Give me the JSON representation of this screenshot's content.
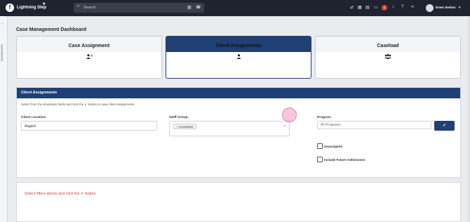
{
  "app": {
    "logo_letter": "f",
    "name": "Lightning Step"
  },
  "search": {
    "placeholder": "Search"
  },
  "notifications": {
    "count": "1"
  },
  "user": {
    "name": "Drew Serkez"
  },
  "rail": {
    "label": "DASHBOARD"
  },
  "page": {
    "title": "Case Management Dashboard"
  },
  "tiles": [
    {
      "label": "Case Assignment",
      "icon": "user-plus-icon"
    },
    {
      "label": "Client Assignments",
      "icon": "user-icon",
      "active": true
    },
    {
      "label": "Caseload",
      "icon": "users-icon"
    }
  ],
  "panel": {
    "title": "Client Assignments",
    "instruction": "Select from the dropdown fields and click the ✔ button to view client assignments",
    "client_location": {
      "label": "Client Location:",
      "value": "Asgard"
    },
    "staff_group": {
      "label": "Staff Group:",
      "tag": "Counselor",
      "tag_remove": "×"
    },
    "program": {
      "label": "Program",
      "placeholder": "All Programs"
    },
    "submit_icon": "check-icon",
    "unassigned_label": "Unassigned",
    "future_label": "Include Future Admissions"
  },
  "result": {
    "message": "Select filters above and click the ✔ button"
  },
  "colors": {
    "primary": "#203f73",
    "topbar": "#1f2330",
    "error": "#d53c3c",
    "badge": "#e03e3e"
  }
}
